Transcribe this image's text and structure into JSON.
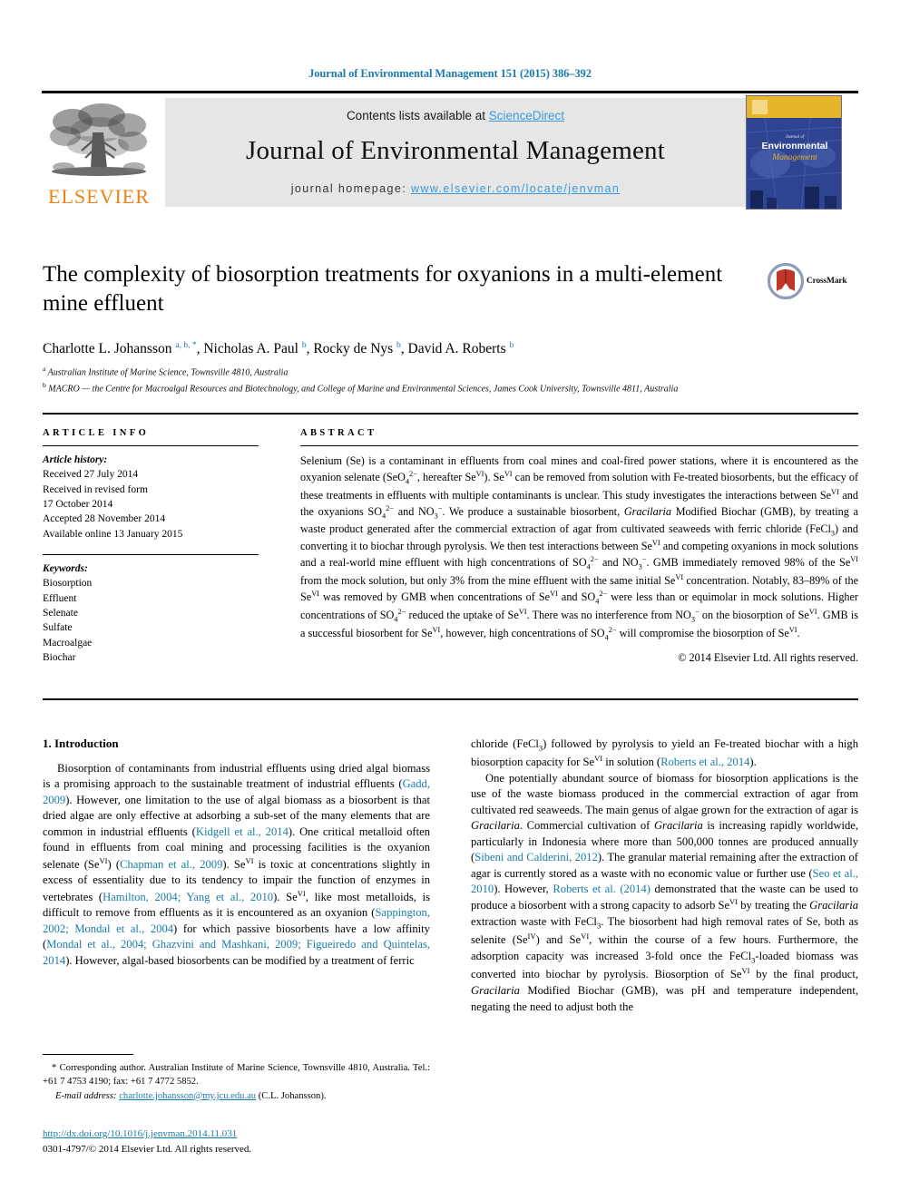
{
  "running_head": "Journal of Environmental Management 151 (2015) 386–392",
  "masthead": {
    "contents_prefix": "Contents lists available at ",
    "sciencedirect": "ScienceDirect",
    "journal_title": "Journal of Environmental Management",
    "homepage_prefix": "journal homepage: ",
    "homepage_url": "www.elsevier.com/locate/jenvman",
    "publisher_wordmark": "ELSEVIER",
    "cover_line1": "Journal of",
    "cover_line2": "Environmental",
    "cover_line3": "Management"
  },
  "article": {
    "title": "The complexity of biosorption treatments for oxyanions in a multi-element mine effluent",
    "authors_html": "Charlotte L. Johansson <sup>a, b, *</sup>, Nicholas A. Paul <sup>b</sup>, Rocky de Nys <sup>b</sup>, David A. Roberts <sup>b</sup>",
    "affiliation_a": "Australian Institute of Marine Science, Townsville 4810, Australia",
    "affiliation_b": "MACRO — the Centre for Macroalgal Resources and Biotechnology, and College of Marine and Environmental Sciences, James Cook University, Townsville 4811, Australia",
    "crossmark_label": "CrossMark"
  },
  "article_info": {
    "heading": "ARTICLE INFO",
    "history_label": "Article history:",
    "history_lines": [
      "Received 27 July 2014",
      "Received in revised form",
      "17 October 2014",
      "Accepted 28 November 2014",
      "Available online 13 January 2015"
    ],
    "keywords_label": "Keywords:",
    "keywords": [
      "Biosorption",
      "Effluent",
      "Selenate",
      "Sulfate",
      "Macroalgae",
      "Biochar"
    ]
  },
  "abstract": {
    "heading": "ABSTRACT",
    "text_html": "Selenium (Se) is a contaminant in effluents from coal mines and coal-fired power stations, where it is encountered as the oxyanion selenate (SeO<sub class=\"num\">4</sub><sup class=\"num\">2−</sup>, hereafter Se<sup class=\"num\">VI</sup>). Se<sup class=\"num\">VI</sup> can be removed from solution with Fe-treated biosorbents, but the efficacy of these treatments in effluents with multiple contaminants is unclear. This study investigates the interactions between Se<sup class=\"num\">VI</sup> and the oxyanions SO<sub class=\"num\">4</sub><sup class=\"num\">2−</sup> and NO<sub class=\"num\">3</sub><sup class=\"num\">−</sup>. We produce a sustainable biosorbent, <i>Gracilaria</i> Modified Biochar (GMB), by treating a waste product generated after the commercial extraction of agar from cultivated seaweeds with ferric chloride (FeCl<sub class=\"num\">3</sub>) and converting it to biochar through pyrolysis. We then test interactions between Se<sup class=\"num\">VI</sup> and competing oxyanions in mock solutions and a real-world mine effluent with high concentrations of SO<sub class=\"num\">4</sub><sup class=\"num\">2−</sup> and NO<sub class=\"num\">3</sub><sup class=\"num\">−</sup>. GMB immediately removed 98% of the Se<sup class=\"num\">VI</sup> from the mock solution, but only 3% from the mine effluent with the same initial Se<sup class=\"num\">VI</sup> concentration. Notably, 83–89% of the Se<sup class=\"num\">VI</sup> was removed by GMB when concentrations of Se<sup class=\"num\">VI</sup> and SO<sub class=\"num\">4</sub><sup class=\"num\">2−</sup> were less than or equimolar in mock solutions. Higher concentrations of SO<sub class=\"num\">4</sub><sup class=\"num\">2−</sup> reduced the uptake of Se<sup class=\"num\">VI</sup>. There was no interference from NO<sub class=\"num\">3</sub><sup class=\"num\">−</sup> on the biosorption of Se<sup class=\"num\">VI</sup>. GMB is a successful biosorbent for Se<sup class=\"num\">VI</sup>, however, high concentrations of SO<sub class=\"num\">4</sub><sup class=\"num\">2−</sup> will compromise the biosorption of Se<sup class=\"num\">VI</sup>.",
    "copyright": "© 2014 Elsevier Ltd. All rights reserved."
  },
  "body": {
    "section_heading": "1. Introduction",
    "left_para_1_html": "Biosorption of contaminants from industrial effluents using dried algal biomass is a promising approach to the sustainable treatment of industrial effluents (<span class=\"cite\">Gadd, 2009</span>). However, one limitation to the use of algal biomass as a biosorbent is that dried algae are only effective at adsorbing a sub-set of the many elements that are common in industrial effluents (<span class=\"cite\">Kidgell et al., 2014</span>). One critical metalloid often found in effluents from coal mining and processing facilities is the oxyanion selenate (Se<sup class=\"num\">VI</sup>) (<span class=\"cite\">Chapman et al., 2009</span>). Se<sup class=\"num\">VI</sup> is toxic at concentrations slightly in excess of essentiality due to its tendency to impair the function of enzymes in vertebrates (<span class=\"cite\">Hamilton, 2004; Yang et al., 2010</span>). Se<sup class=\"num\">VI</sup>, like most metalloids, is difficult to remove from effluents as it is encountered as an oxyanion (<span class=\"cite\">Sappington, 2002; Mondal et al., 2004</span>) for which passive biosorbents have a low affinity (<span class=\"cite\">Mondal et al., 2004; Ghazvini and Mashkani, 2009; Figueiredo and Quintelas, 2014</span>). However, algal-based biosorbents can be modified by a treatment of ferric",
    "right_para_1_html": "chloride (FeCl<sub class=\"num\">3</sub>) followed by pyrolysis to yield an Fe-treated biochar with a high biosorption capacity for Se<sup class=\"num\">VI</sup> in solution (<span class=\"cite\">Roberts et al., 2014</span>).",
    "right_para_2_html": "One potentially abundant source of biomass for biosorption applications is the use of the waste biomass produced in the commercial extraction of agar from cultivated red seaweeds. The main genus of algae grown for the extraction of agar is <i>Gracilaria</i>. Commercial cultivation of <i>Gracilaria</i> is increasing rapidly worldwide, particularly in Indonesia where more than 500,000 tonnes are produced annually (<span class=\"cite\">Sibeni and Calderini, 2012</span>). The granular material remaining after the extraction of agar is currently stored as a waste with no economic value or further use (<span class=\"cite\">Seo et al., 2010</span>). However, <span class=\"cite\">Roberts et al. (2014)</span> demonstrated that the waste can be used to produce a biosorbent with a strong capacity to adsorb Se<sup class=\"num\">VI</sup> by treating the <i>Gracilaria</i> extraction waste with FeCl<sub class=\"num\">3</sub>. The biosorbent had high removal rates of Se, both as selenite (Se<sup class=\"num\">IV</sup>) and Se<sup class=\"num\">VI</sup>, within the course of a few hours. Furthermore, the adsorption capacity was increased 3-fold once the FeCl<sub class=\"num\">3</sub>-loaded biomass was converted into biochar by pyrolysis. Biosorption of Se<sup class=\"num\">VI</sup> by the final product, <i>Gracilaria</i> Modified Biochar (GMB), was pH and temperature independent, negating the need to adjust both the"
  },
  "footnote": {
    "corresponding_html": "* Corresponding author. Australian Institute of Marine Science, Townsville 4810, Australia. Tel.: +61 7 4753 4190; fax: +61 7 4772 5852.",
    "email_label": "E-mail address:",
    "email": "charlotte.johansson@my.jcu.edu.au",
    "email_suffix": "(C.L. Johansson)."
  },
  "doi": {
    "url": "http://dx.doi.org/10.1016/j.jenvman.2014.11.031",
    "issn_line": "0301-4797/© 2014 Elsevier Ltd. All rights reserved."
  },
  "colors": {
    "link_blue": "#1a7ba8",
    "sciencedirect_blue": "#3a9bd9",
    "elsevier_orange": "#f08219",
    "band_gray": "#e6e6e6",
    "cover_blue": "#2b3f8c",
    "cover_yellow": "#e8b42a",
    "crossmark_red": "#c0372a"
  }
}
